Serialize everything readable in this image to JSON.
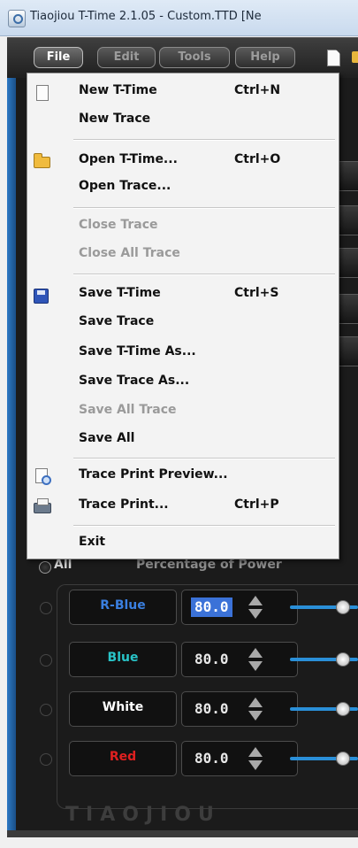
{
  "window": {
    "title": "Tiaojiou T-Time 2.1.05 - Custom.TTD [Ne"
  },
  "menubar": {
    "items": [
      {
        "label": "File",
        "active": true
      },
      {
        "label": "Edit",
        "active": false
      },
      {
        "label": "Tools",
        "active": false
      },
      {
        "label": "Help",
        "active": false
      }
    ],
    "toolbar_icons": [
      "new-file-icon",
      "open-folder-icon"
    ]
  },
  "file_menu": {
    "items": [
      {
        "label": "New T-Time",
        "shortcut": "Ctrl+N",
        "icon": "new-file-icon",
        "enabled": true
      },
      {
        "label": "New Trace",
        "shortcut": "",
        "icon": "",
        "enabled": true
      },
      {
        "label": "Open T-Time...",
        "shortcut": "Ctrl+O",
        "icon": "open-folder-icon",
        "enabled": true
      },
      {
        "label": "Open Trace...",
        "shortcut": "",
        "icon": "",
        "enabled": true
      },
      {
        "label": "Close Trace",
        "shortcut": "",
        "icon": "",
        "enabled": false
      },
      {
        "label": "Close All Trace",
        "shortcut": "",
        "icon": "",
        "enabled": false
      },
      {
        "label": "Save T-Time",
        "shortcut": "Ctrl+S",
        "icon": "save-disk-icon",
        "enabled": true
      },
      {
        "label": "Save Trace",
        "shortcut": "",
        "icon": "",
        "enabled": true
      },
      {
        "label": "Save T-Time As...",
        "shortcut": "",
        "icon": "",
        "enabled": true
      },
      {
        "label": "Save Trace As...",
        "shortcut": "",
        "icon": "",
        "enabled": true
      },
      {
        "label": "Save All Trace",
        "shortcut": "",
        "icon": "",
        "enabled": false
      },
      {
        "label": "Save All",
        "shortcut": "",
        "icon": "",
        "enabled": true
      },
      {
        "label": "Trace Print Preview...",
        "shortcut": "",
        "icon": "print-preview-icon",
        "enabled": true
      },
      {
        "label": "Trace Print...",
        "shortcut": "Ctrl+P",
        "icon": "printer-icon",
        "enabled": true
      },
      {
        "label": "Exit",
        "shortcut": "",
        "icon": "",
        "enabled": true
      }
    ]
  },
  "power": {
    "all_label": "All",
    "title": "Percentage of Power",
    "channels": [
      {
        "name": "R-Blue",
        "value": "80.0",
        "selected": true,
        "name_color": "#3a7fe0",
        "level": 0.8
      },
      {
        "name": "Blue",
        "value": "80.0",
        "selected": false,
        "name_color": "#29c4c8",
        "level": 0.8
      },
      {
        "name": "White",
        "value": "80.0",
        "selected": false,
        "name_color": "#ffffff",
        "level": 0.8
      },
      {
        "name": "Red",
        "value": "80.0",
        "selected": false,
        "name_color": "#e02020",
        "level": 0.8
      }
    ]
  },
  "brand": {
    "logo_text": "TIAOJIOU"
  },
  "colors": {
    "accent": "#2a8fd8",
    "selection": "#3b72d8",
    "panel": "#1b1b1b"
  }
}
